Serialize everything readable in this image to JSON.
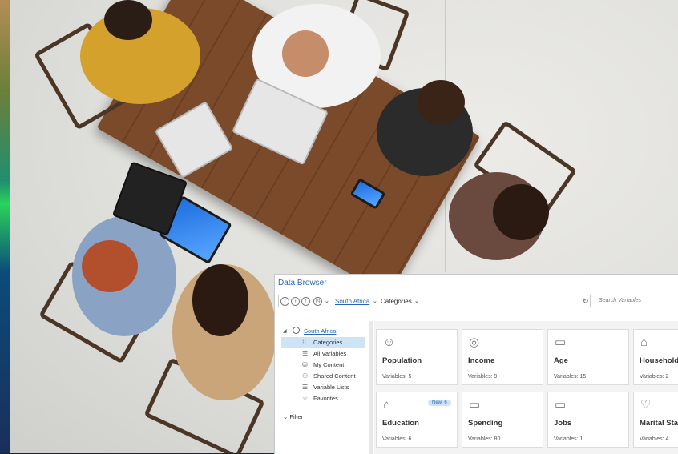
{
  "window": {
    "title": "Data Browser"
  },
  "breadcrumb": {
    "root": "South Africa",
    "current": "Categories"
  },
  "search": {
    "placeholder": "Search Variables"
  },
  "sidebar": {
    "root": "South Africa",
    "items": [
      {
        "label": "Categories",
        "icon": "grid-icon",
        "selected": true
      },
      {
        "label": "All Variables",
        "icon": "list-icon",
        "selected": false
      },
      {
        "label": "My Content",
        "icon": "database-icon",
        "selected": false
      },
      {
        "label": "Shared Content",
        "icon": "shared-users-icon",
        "selected": false
      },
      {
        "label": "Variable Lists",
        "icon": "list-icon",
        "selected": false
      },
      {
        "label": "Favorites",
        "icon": "star-icon",
        "selected": false
      }
    ],
    "filter": "Filter"
  },
  "cards": [
    {
      "title": "Population",
      "variables": "Variables: 5",
      "icon": "people-icon"
    },
    {
      "title": "Income",
      "variables": "Variables: 9",
      "icon": "coins-icon"
    },
    {
      "title": "Age",
      "variables": "Variables: 15",
      "icon": "calendar-icon"
    },
    {
      "title": "Households",
      "variables": "Variables: 2",
      "icon": "house-icon"
    },
    {
      "title": "Education",
      "variables": "Variables: 6",
      "icon": "graduation-cap-icon",
      "badge": "New: 6"
    },
    {
      "title": "Spending",
      "variables": "Variables: 80",
      "icon": "credit-card-icon"
    },
    {
      "title": "Jobs",
      "variables": "Variables: 1",
      "icon": "briefcase-icon"
    },
    {
      "title": "Marital Status",
      "variables": "Variables: 4",
      "icon": "heart-icon"
    }
  ],
  "colors": {
    "accent": "#2a66b3",
    "selected_bg": "#cfe3f7",
    "content_bg": "#f3f3f3"
  }
}
